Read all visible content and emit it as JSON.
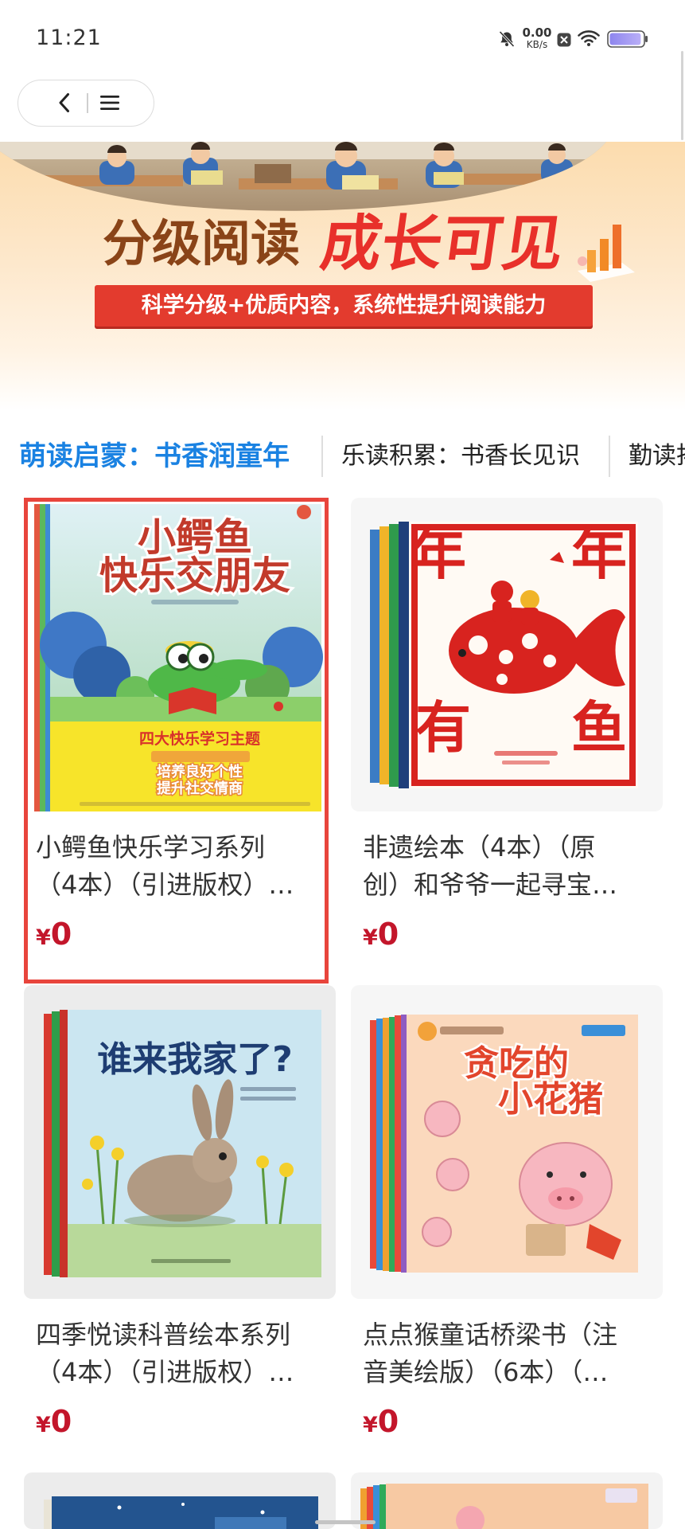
{
  "status_bar": {
    "time": "11:21",
    "net_speed": "0.00",
    "net_speed_unit": "KB/s",
    "icons": [
      "mute-bell-icon",
      "close-box-icon",
      "wifi-icon",
      "battery-icon"
    ],
    "battery_level": 0.95
  },
  "nav": {
    "back_icon": "chevron-left-icon",
    "menu_icon": "menu-icon"
  },
  "banner": {
    "title_left": "分级阅读",
    "title_right": "成长可见",
    "subtitle": "科学分级+优质内容，系统性提升阅读能力",
    "colors": {
      "title_left": "#8a4418",
      "title_right": "#e8302a",
      "strip": "#e33b2e"
    }
  },
  "tabs": [
    {
      "label": "萌读启蒙：书香润童年",
      "active": true
    },
    {
      "label": "乐读积累：书香长见识",
      "active": false
    },
    {
      "label": "勤读拓",
      "active": false
    }
  ],
  "colors": {
    "active_tab": "#1a82e2",
    "price": "#c3162b",
    "selection_outline": "#e8453c"
  },
  "products": [
    {
      "title_lines": [
        "小鳄鱼快乐学习系列",
        "（4本）（引进版权）…"
      ],
      "currency": "¥",
      "price": "0",
      "selected": true,
      "cover": {
        "title_lines": [
          "小鳄鱼",
          "快乐交朋友"
        ],
        "band_lines": [
          "四大快乐学习主题",
          "培养良好个性",
          "提升社交情商"
        ]
      }
    },
    {
      "title_lines": [
        "非遗绘本（4本）（原",
        "创）和爷爷一起寻宝…"
      ],
      "currency": "¥",
      "price": "0",
      "selected": false,
      "cover": {
        "characters": [
          "年",
          "年",
          "有",
          "鱼"
        ]
      }
    },
    {
      "title_lines": [
        "四季悦读科普绘本系列",
        "（4本）（引进版权）…"
      ],
      "currency": "¥",
      "price": "0",
      "selected": false,
      "cover": {
        "title": "谁来我家了?"
      }
    },
    {
      "title_lines": [
        "点点猴童话桥梁书（注",
        "音美绘版）（6本）（…"
      ],
      "currency": "¥",
      "price": "0",
      "selected": false,
      "cover": {
        "title_lines": [
          "贪吃的",
          "小花猪"
        ]
      }
    }
  ]
}
